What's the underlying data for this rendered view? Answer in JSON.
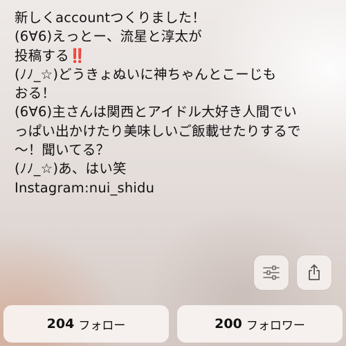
{
  "bio": {
    "lines": [
      "新しくaccountつくりました！",
      "(6∀6)えっとー、流星と淳太が",
      "投稿する‼️",
      "(ﾉﾉ_☆)どうきょぬいに神ちゃんとこーじも",
      "おる！",
      "(6∀6)主さんは関西とアイドル大好き人間でい",
      "っぱい出かけたり美味しいご飯載せたりするで",
      "〜！聞いてる？",
      "(ﾉﾉ_☆)あ、はい笑",
      "Instagram:nui_shidu"
    ]
  },
  "actions": {
    "filter_icon": "sliders-icon",
    "share_icon": "share-icon"
  },
  "stats": {
    "following": {
      "count": "204",
      "label": "フォロー"
    },
    "followers": {
      "count": "200",
      "label": "フォロワー"
    }
  }
}
